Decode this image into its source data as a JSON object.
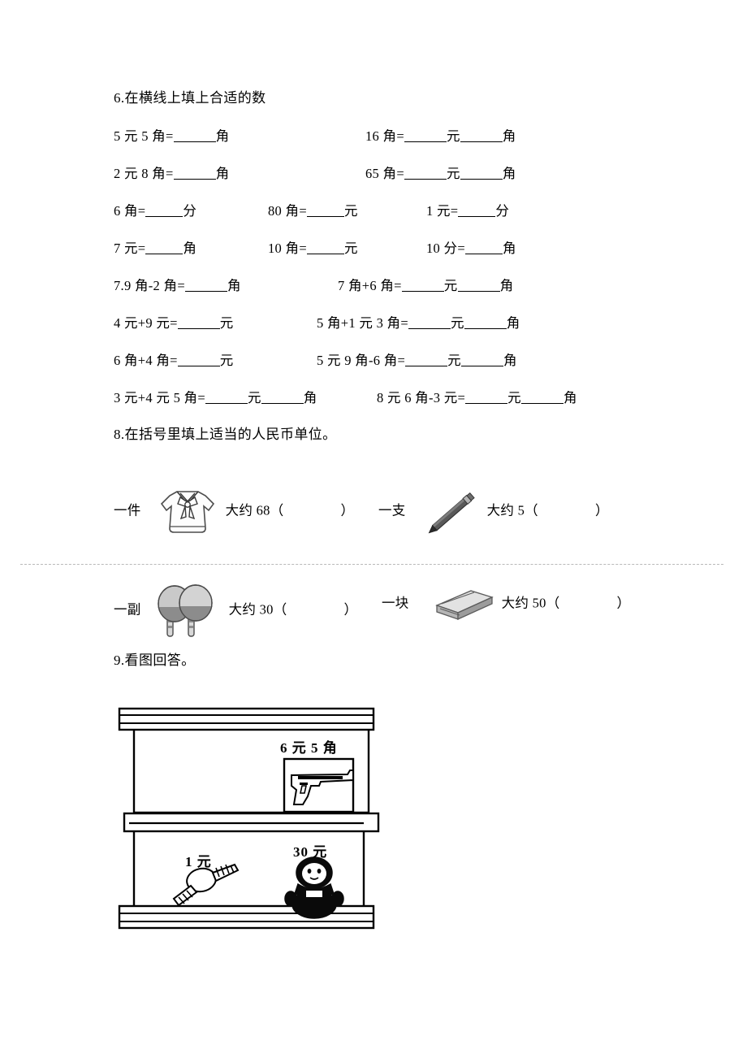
{
  "section6": {
    "heading": "6.在横线上填上合适的数",
    "rows": [
      {
        "left": {
          "prefix": "5 元 5 角=",
          "blanks": 1,
          "units": [
            "角"
          ]
        },
        "right": {
          "prefix": "16 角=",
          "blanks": 2,
          "units": [
            "元",
            "角"
          ]
        }
      },
      {
        "left": {
          "prefix": "2 元 8 角=",
          "blanks": 1,
          "units": [
            "角"
          ]
        },
        "right": {
          "prefix": "65 角=",
          "blanks": 2,
          "units": [
            "元",
            "角"
          ]
        }
      }
    ],
    "triple_rows": [
      {
        "a": {
          "prefix": "6 角=",
          "unit": "分"
        },
        "b": {
          "prefix": "80 角=",
          "unit": "元"
        },
        "c": {
          "prefix": "1 元=",
          "unit": "分"
        }
      },
      {
        "a": {
          "prefix": "7 元=",
          "unit": "角"
        },
        "b": {
          "prefix": "10 角=",
          "unit": "元"
        },
        "c": {
          "prefix": "10 分=",
          "unit": "角"
        }
      }
    ]
  },
  "section7": {
    "rows": [
      {
        "left": {
          "prefix": "7.9 角-2 角=",
          "blanks": 1,
          "units": [
            "角"
          ]
        },
        "right": {
          "prefix": "7 角+6 角=",
          "blanks": 2,
          "units": [
            "元",
            "角"
          ]
        }
      },
      {
        "left": {
          "prefix": "4 元+9 元=",
          "blanks": 1,
          "units": [
            "元"
          ]
        },
        "right": {
          "prefix": "5 角+1 元 3 角=",
          "blanks": 2,
          "units": [
            "元",
            "角"
          ]
        }
      },
      {
        "left": {
          "prefix": "6 角+4 角=",
          "blanks": 1,
          "units": [
            "元"
          ]
        },
        "right": {
          "prefix": "5 元 9 角-6 角=",
          "blanks": 2,
          "units": [
            "元",
            "角"
          ]
        }
      },
      {
        "left": {
          "prefix": "3 元+4 元 5 角=",
          "blanks": 2,
          "units": [
            "元",
            "角"
          ]
        },
        "right": {
          "prefix": "8 元 6 角-3 元=",
          "blanks": 2,
          "units": [
            "元",
            "角"
          ]
        }
      }
    ]
  },
  "section8": {
    "heading": "8.在括号里填上适当的人民币单位。",
    "items": [
      {
        "counter": "一件",
        "icon": "shirt-icon",
        "text": "大约 68（",
        "close": "）"
      },
      {
        "counter": "一支",
        "icon": "pencil-icon",
        "text": "大约 5（",
        "close": "）"
      },
      {
        "counter": "一副",
        "icon": "paddles-icon",
        "text": "大约 30（",
        "close": "）"
      },
      {
        "counter": "一块",
        "icon": "eraser-icon",
        "text": "大约 50（",
        "close": "）"
      }
    ]
  },
  "section9": {
    "heading": "9.看图回答。",
    "shelf": {
      "upper_items": [
        {
          "name": "toy-gun",
          "price": "6 元 5 角"
        }
      ],
      "lower_items": [
        {
          "name": "watch",
          "price": "1 元"
        },
        {
          "name": "doll",
          "price": "30 元"
        }
      ]
    }
  }
}
